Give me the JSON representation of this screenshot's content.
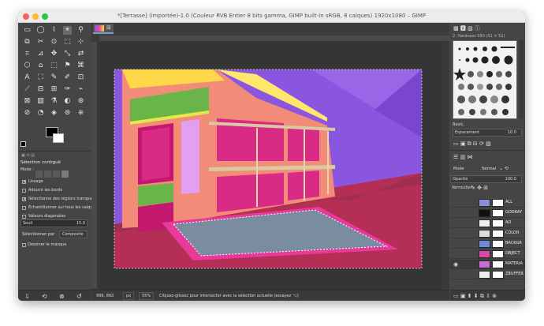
{
  "window": {
    "title": "*[Terrasse] (importée)-1.0 (Couleur RVB Entier 8 bits gamma, GIMP built-in sRGB, 8 calques) 1920x1080 – GIMP"
  },
  "toolbox": {
    "section_title": "Sélection contiguë",
    "mode_label": "Mode :",
    "options": [
      {
        "label": "Lissage",
        "checked": true
      },
      {
        "label": "Adoucir les bords",
        "checked": false
      },
      {
        "label": "Sélectionne des régions transparentes",
        "checked": true
      },
      {
        "label": "Échantillonner sur tous les calques",
        "checked": false
      },
      {
        "label": "Valeurs diagonales",
        "checked": false
      }
    ],
    "threshold_label": "Seuil",
    "threshold_value": "15.0",
    "select_by_label": "Sélectionner par",
    "select_by_value": "Composite",
    "draw_mask_label": "Dessiner le masque"
  },
  "status": {
    "coords": "996, 892",
    "unit": "px",
    "zoom": "55%",
    "message": "Cliquez-glissez pour intersecter avec la sélection actuelle (essayez ⌥)"
  },
  "brushes": {
    "header": "2. Hardness 050 (51 × 51)",
    "filter": "Basic,",
    "spacing_label": "Espacement",
    "spacing_value": "10.0"
  },
  "layers_panel": {
    "mode_label": "Mode",
    "mode_value": "Normal",
    "opacity_label": "Opacité",
    "opacity_value": "100.0",
    "lock_label": "Verrouiller :",
    "layers": [
      {
        "name": "ALL",
        "thumb": "#8a8fd6"
      },
      {
        "name": "GODRAY",
        "thumb": "#111111"
      },
      {
        "name": "AO",
        "thumb": "#eeeeee"
      },
      {
        "name": "COLOR",
        "thumb": "#dddddd"
      },
      {
        "name": "BACKGR",
        "thumb": "#6b8bd8"
      },
      {
        "name": "OBJECT",
        "thumb": "#d64aa8"
      },
      {
        "name": "MATERIA",
        "thumb": "#c96bd8"
      },
      {
        "name": "ZBUFFER",
        "thumb": "#eeeeee"
      }
    ]
  }
}
